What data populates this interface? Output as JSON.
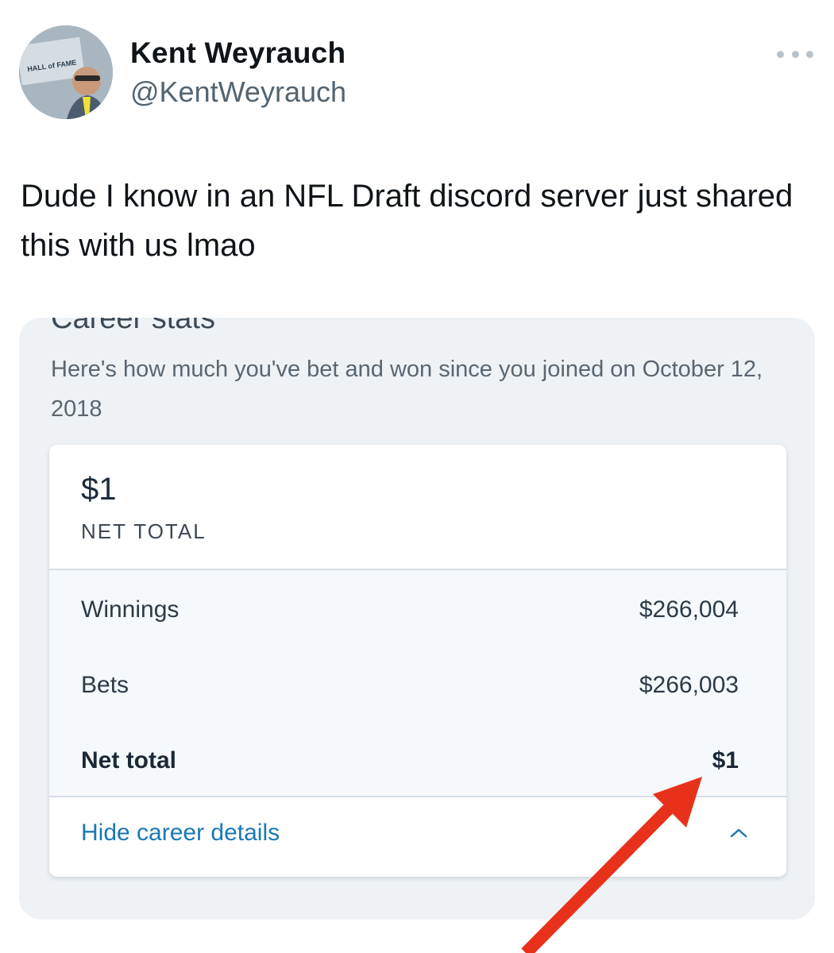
{
  "tweet": {
    "author_name": "Kent Weyrauch",
    "author_handle": "@KentWeyrauch",
    "text": "Dude I know in an NFL Draft discord server just shared this with us lmao",
    "avatar_sign_text": "HALL of FAME"
  },
  "card": {
    "title": "Career stats",
    "subtitle": "Here's how much you've bet and won since you joined on October 12, 2018",
    "net_total_amount": "$1",
    "net_total_label": "NET TOTAL",
    "rows": [
      {
        "label": "Winnings",
        "value": "$266,004"
      },
      {
        "label": "Bets",
        "value": "$266,003"
      },
      {
        "label": "Net total",
        "value": "$1"
      }
    ],
    "hide_details_label": "Hide career details"
  },
  "icons": {
    "more": "more-horizontal-icon",
    "caret": "chevron-up-icon",
    "annotation": "red-arrow-annotation"
  },
  "colors": {
    "link": "#1a78b5",
    "card_bg": "#eef2f5",
    "arrow": "#e8311a",
    "handle": "#536471"
  }
}
